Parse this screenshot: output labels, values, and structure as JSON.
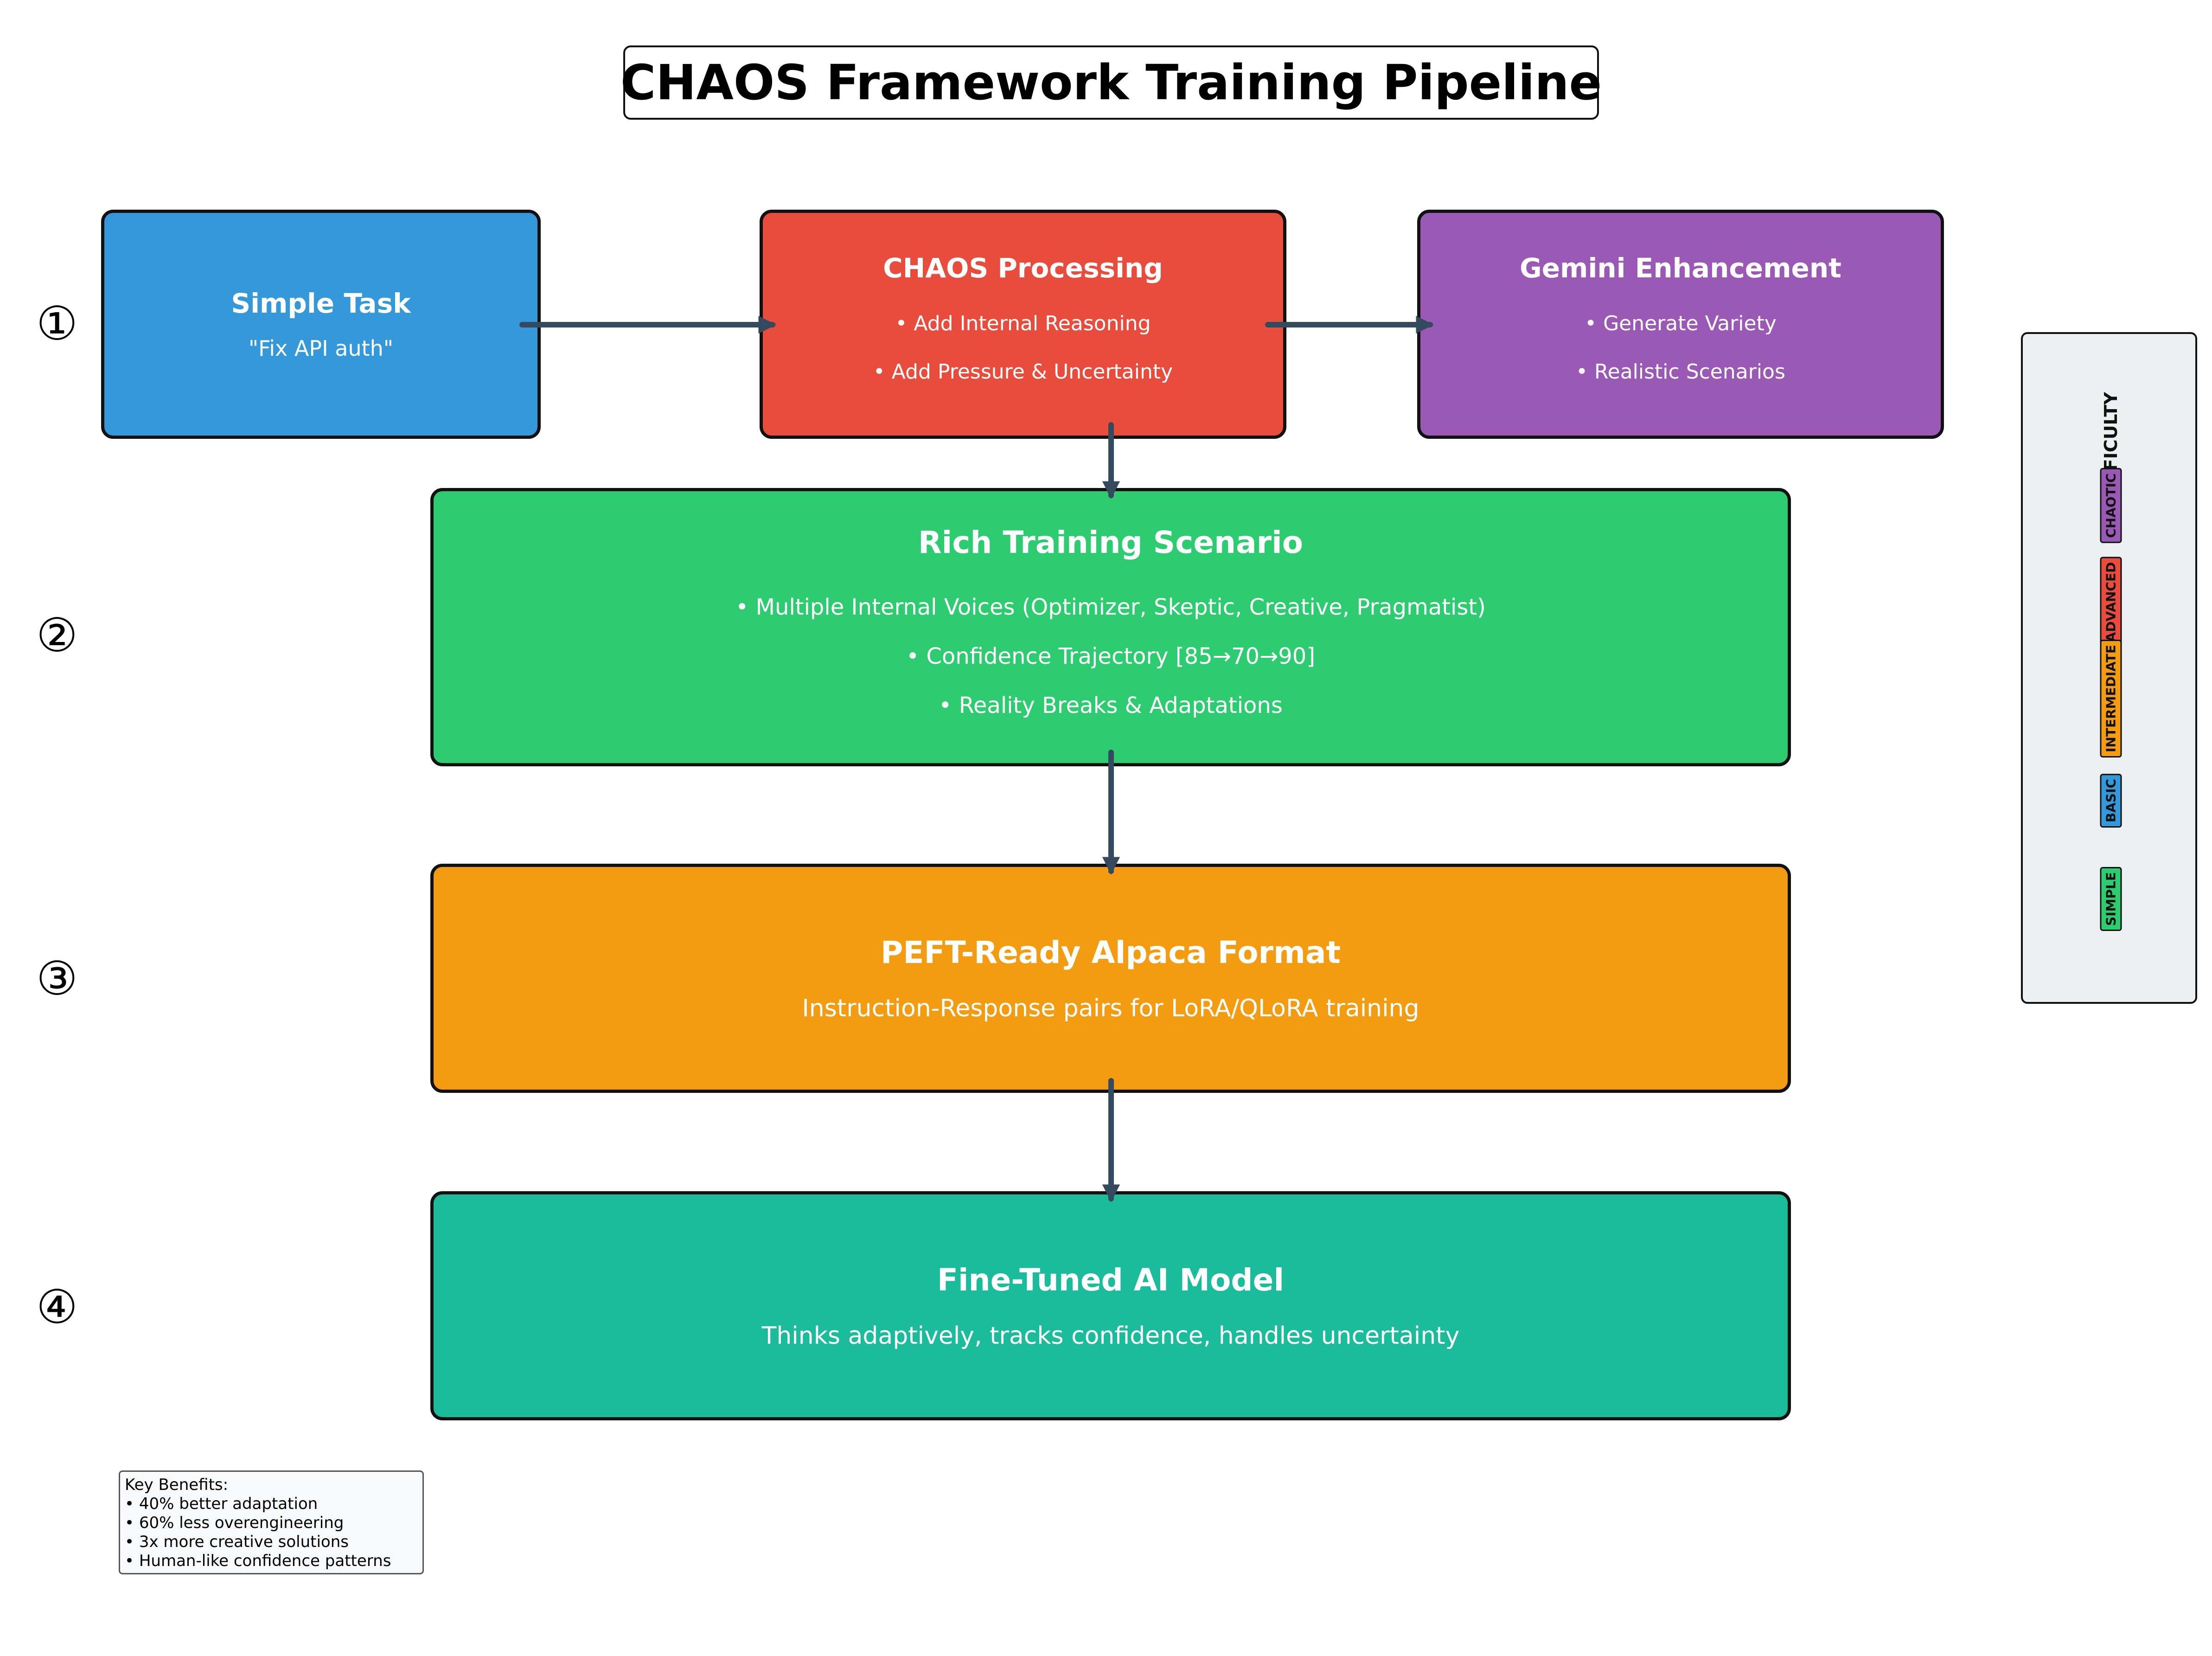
{
  "title": "CHAOS Framework Training Pipeline",
  "steps": [
    "①",
    "②",
    "③",
    "④"
  ],
  "simple_task": {
    "title": "Simple Task",
    "lines": [
      "\"Fix API auth\""
    ]
  },
  "chaos_processing": {
    "title": "CHAOS Processing",
    "lines": [
      "• Add Internal Reasoning",
      "• Add Pressure & Uncertainty"
    ]
  },
  "gemini_enhancement": {
    "title": "Gemini Enhancement",
    "lines": [
      "• Generate Variety",
      "• Realistic Scenarios"
    ]
  },
  "rich_scenario": {
    "title": "Rich Training Scenario",
    "lines": [
      "• Multiple Internal Voices (Optimizer, Skeptic, Creative, Pragmatist)",
      "• Confidence Trajectory [85→70→90]",
      "• Reality Breaks & Adaptations"
    ]
  },
  "peft_format": {
    "title": "PEFT-Ready Alpaca Format",
    "lines": [
      "Instruction-Response pairs for LoRA/QLoRA training"
    ]
  },
  "fine_tuned": {
    "title": "Fine-Tuned AI Model",
    "lines": [
      "Thinks adaptively, tracks confidence, handles uncertainty"
    ]
  },
  "difficulty": {
    "title": "DIFFICULTY",
    "levels": [
      {
        "label": "CHAOTIC",
        "color": "#9b59b6"
      },
      {
        "label": "ADVANCED",
        "color": "#e74c3c"
      },
      {
        "label": "INTERMEDIATE",
        "color": "#f39c12"
      },
      {
        "label": "BASIC",
        "color": "#3498db"
      },
      {
        "label": "SIMPLE",
        "color": "#2ecc71"
      }
    ]
  },
  "benefits": {
    "heading": "Key Benefits:",
    "items": [
      "• 40% better adaptation",
      "• 60% less overengineering",
      "• 3x more creative solutions",
      "• Human-like confidence patterns"
    ]
  },
  "colors": {
    "simple_task": "#3498db",
    "chaos_processing": "#e74c3c",
    "gemini_enhancement": "#9b59b6",
    "rich_scenario": "#2ecc71",
    "peft_format": "#f39c12",
    "fine_tuned": "#1abc9c",
    "arrow": "#34495e"
  }
}
